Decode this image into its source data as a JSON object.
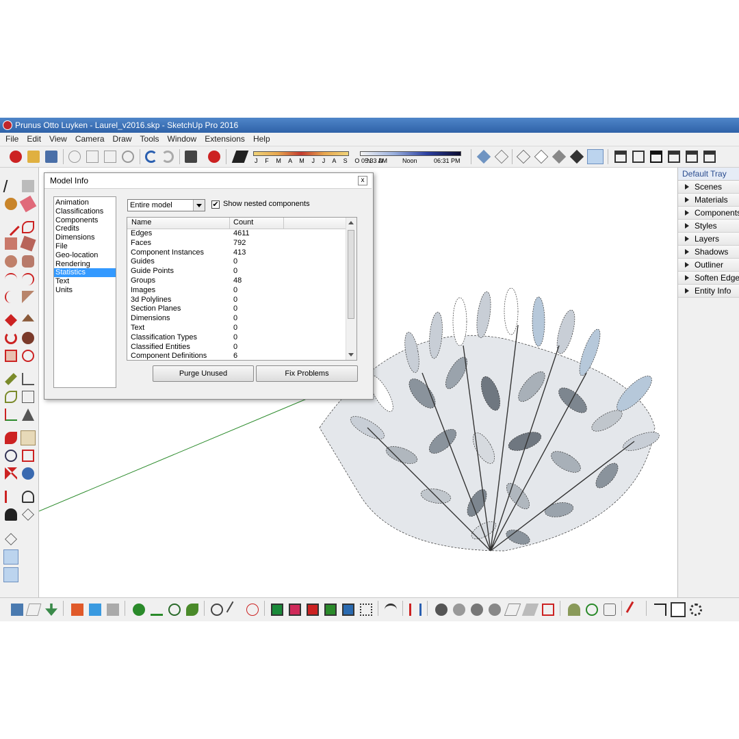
{
  "window": {
    "title": "Prunus Otto Luyken - Laurel_v2016.skp - SketchUp Pro 2016"
  },
  "menu": [
    "File",
    "Edit",
    "View",
    "Camera",
    "Draw",
    "Tools",
    "Window",
    "Extensions",
    "Help"
  ],
  "shadow_settings": {
    "months_label": "J F M A M J J A S O N D",
    "time_start": "05:33 AM",
    "time_mid": "Noon",
    "time_end": "06:31 PM"
  },
  "model_info": {
    "title": "Model Info",
    "close_label": "x",
    "categories": [
      "Animation",
      "Classifications",
      "Components",
      "Credits",
      "Dimensions",
      "File",
      "Geo-location",
      "Rendering",
      "Statistics",
      "Text",
      "Units"
    ],
    "selected_category": "Statistics",
    "scope_value": "Entire model",
    "show_nested_checked": true,
    "show_nested_label": "Show nested components",
    "columns": {
      "name": "Name",
      "count": "Count"
    },
    "rows": [
      {
        "name": "Edges",
        "count": "4611"
      },
      {
        "name": "Faces",
        "count": "792"
      },
      {
        "name": "Component Instances",
        "count": "413"
      },
      {
        "name": "Guides",
        "count": "0"
      },
      {
        "name": "Guide Points",
        "count": "0"
      },
      {
        "name": "Groups",
        "count": "48"
      },
      {
        "name": "Images",
        "count": "0"
      },
      {
        "name": "3d Polylines",
        "count": "0"
      },
      {
        "name": "Section Planes",
        "count": "0"
      },
      {
        "name": "Dimensions",
        "count": "0"
      },
      {
        "name": "Text",
        "count": "0"
      },
      {
        "name": "Classification Types",
        "count": "0"
      },
      {
        "name": "Classified Entities",
        "count": "0"
      },
      {
        "name": "Component Definitions",
        "count": "6"
      }
    ],
    "purge_label": "Purge Unused",
    "fix_label": "Fix Problems"
  },
  "tray": {
    "title": "Default Tray",
    "items": [
      "Scenes",
      "Materials",
      "Components",
      "Styles",
      "Layers",
      "Shadows",
      "Outliner",
      "Soften Edges",
      "Entity Info"
    ]
  },
  "colors": {
    "titlebar": "#3a6fb8",
    "selection": "#3399ff",
    "green_axis": "#2a8a2a"
  }
}
